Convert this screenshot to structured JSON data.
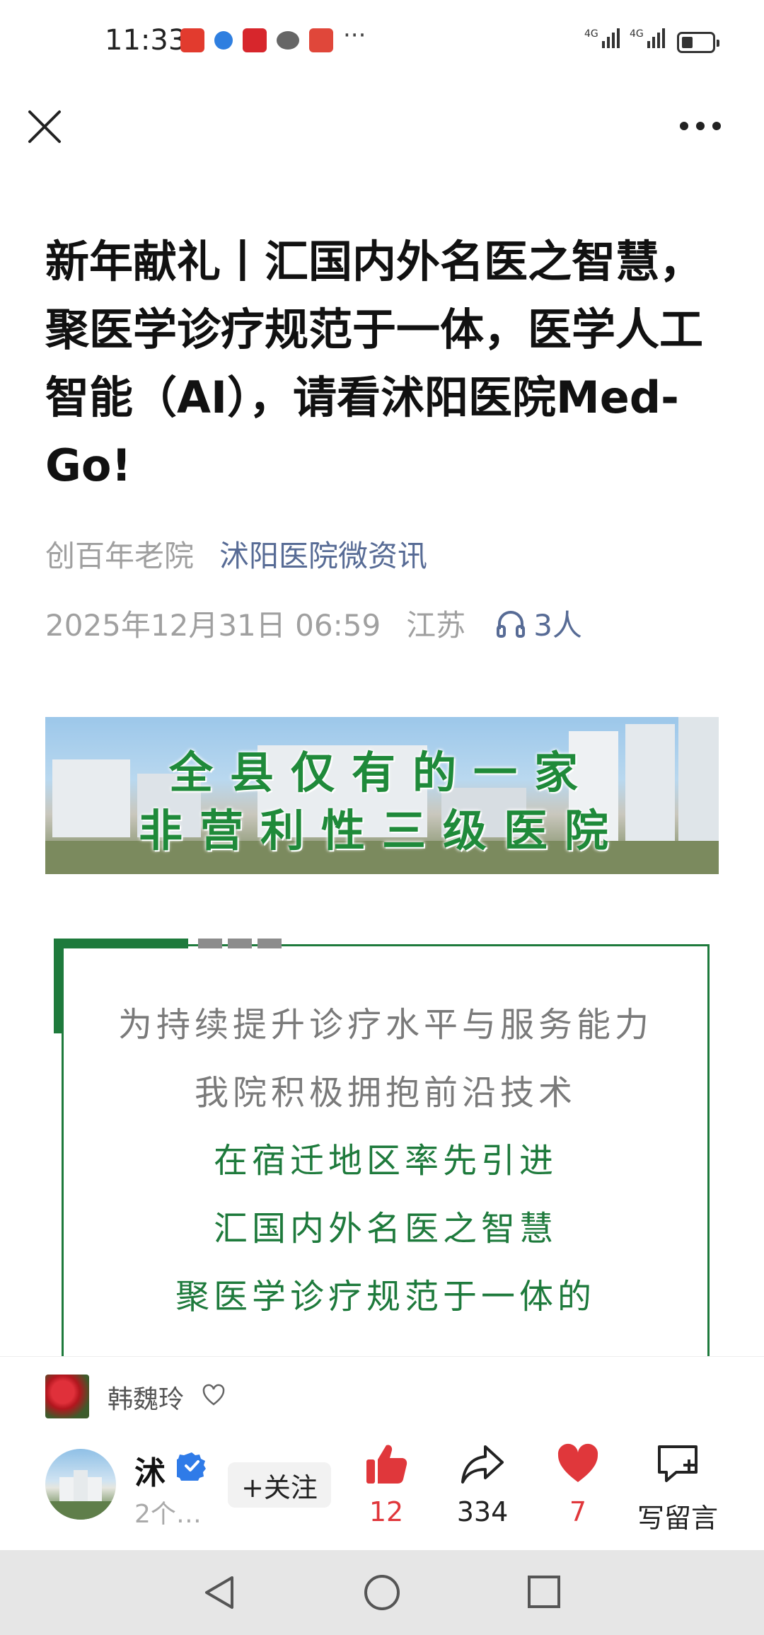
{
  "status_bar": {
    "time": "11:33",
    "network_1": "4G",
    "network_2": "4G",
    "app_icons": [
      "app-icon-red",
      "app-icon-blue",
      "app-icon-red-2",
      "chat-icon",
      "app-icon-red-3"
    ],
    "more": "···"
  },
  "nav": {
    "close_icon": "close-icon",
    "more_icon": "more-dots-icon"
  },
  "article": {
    "title": "新年献礼丨汇国内外名医之智慧，聚医学诊疗规范于一体，医学人工智能（AI），请看沭阳医院Med-Go!",
    "author_tag": "创百年老院",
    "account": "沭阳医院微资讯",
    "date": "2025年12月31日 06:59",
    "region": "江苏",
    "listeners": "3人"
  },
  "banner": {
    "line1": "全县仅有的一家",
    "line2": "非营利性三级医院"
  },
  "content_box": {
    "lines": [
      {
        "text": "为持续提升诊疗水平与服务能力",
        "color": "gray"
      },
      {
        "text": "我院积极拥抱前沿技术",
        "color": "gray"
      },
      {
        "text": "在宿迁地区率先引进",
        "color": "green"
      },
      {
        "text": "汇国内外名医之智慧",
        "color": "green"
      },
      {
        "text": "聚医学诊疗规范于一体的",
        "color": "green"
      }
    ]
  },
  "bottom": {
    "reader_name": "韩魏玲",
    "author_name": "沭",
    "author_sub": "2个…",
    "follow_label": "+关注",
    "likes": "12",
    "shares": "334",
    "hearts": "7",
    "comment_label": "写留言"
  },
  "colors": {
    "accent_green": "#1e7a3c",
    "link_blue": "#576b95",
    "like_red": "#e0373b"
  }
}
